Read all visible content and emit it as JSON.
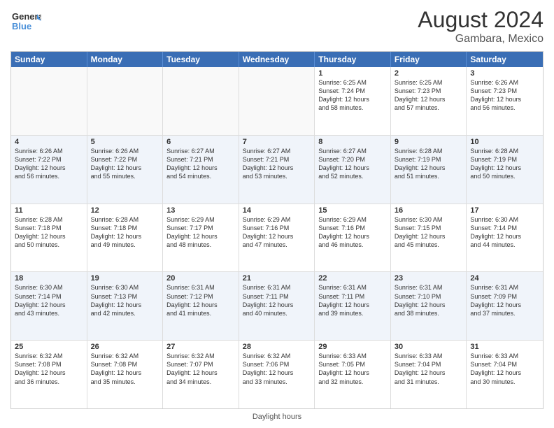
{
  "logo": {
    "general": "General",
    "blue": "Blue"
  },
  "title": "August 2024",
  "subtitle": "Gambara, Mexico",
  "days": [
    "Sunday",
    "Monday",
    "Tuesday",
    "Wednesday",
    "Thursday",
    "Friday",
    "Saturday"
  ],
  "rows": [
    [
      {
        "day": "",
        "text": "",
        "empty": true
      },
      {
        "day": "",
        "text": "",
        "empty": true
      },
      {
        "day": "",
        "text": "",
        "empty": true
      },
      {
        "day": "",
        "text": "",
        "empty": true
      },
      {
        "day": "1",
        "text": "Sunrise: 6:25 AM\nSunset: 7:24 PM\nDaylight: 12 hours\nand 58 minutes.",
        "empty": false
      },
      {
        "day": "2",
        "text": "Sunrise: 6:25 AM\nSunset: 7:23 PM\nDaylight: 12 hours\nand 57 minutes.",
        "empty": false
      },
      {
        "day": "3",
        "text": "Sunrise: 6:26 AM\nSunset: 7:23 PM\nDaylight: 12 hours\nand 56 minutes.",
        "empty": false
      }
    ],
    [
      {
        "day": "4",
        "text": "Sunrise: 6:26 AM\nSunset: 7:22 PM\nDaylight: 12 hours\nand 56 minutes.",
        "empty": false
      },
      {
        "day": "5",
        "text": "Sunrise: 6:26 AM\nSunset: 7:22 PM\nDaylight: 12 hours\nand 55 minutes.",
        "empty": false
      },
      {
        "day": "6",
        "text": "Sunrise: 6:27 AM\nSunset: 7:21 PM\nDaylight: 12 hours\nand 54 minutes.",
        "empty": false
      },
      {
        "day": "7",
        "text": "Sunrise: 6:27 AM\nSunset: 7:21 PM\nDaylight: 12 hours\nand 53 minutes.",
        "empty": false
      },
      {
        "day": "8",
        "text": "Sunrise: 6:27 AM\nSunset: 7:20 PM\nDaylight: 12 hours\nand 52 minutes.",
        "empty": false
      },
      {
        "day": "9",
        "text": "Sunrise: 6:28 AM\nSunset: 7:19 PM\nDaylight: 12 hours\nand 51 minutes.",
        "empty": false
      },
      {
        "day": "10",
        "text": "Sunrise: 6:28 AM\nSunset: 7:19 PM\nDaylight: 12 hours\nand 50 minutes.",
        "empty": false
      }
    ],
    [
      {
        "day": "11",
        "text": "Sunrise: 6:28 AM\nSunset: 7:18 PM\nDaylight: 12 hours\nand 50 minutes.",
        "empty": false
      },
      {
        "day": "12",
        "text": "Sunrise: 6:28 AM\nSunset: 7:18 PM\nDaylight: 12 hours\nand 49 minutes.",
        "empty": false
      },
      {
        "day": "13",
        "text": "Sunrise: 6:29 AM\nSunset: 7:17 PM\nDaylight: 12 hours\nand 48 minutes.",
        "empty": false
      },
      {
        "day": "14",
        "text": "Sunrise: 6:29 AM\nSunset: 7:16 PM\nDaylight: 12 hours\nand 47 minutes.",
        "empty": false
      },
      {
        "day": "15",
        "text": "Sunrise: 6:29 AM\nSunset: 7:16 PM\nDaylight: 12 hours\nand 46 minutes.",
        "empty": false
      },
      {
        "day": "16",
        "text": "Sunrise: 6:30 AM\nSunset: 7:15 PM\nDaylight: 12 hours\nand 45 minutes.",
        "empty": false
      },
      {
        "day": "17",
        "text": "Sunrise: 6:30 AM\nSunset: 7:14 PM\nDaylight: 12 hours\nand 44 minutes.",
        "empty": false
      }
    ],
    [
      {
        "day": "18",
        "text": "Sunrise: 6:30 AM\nSunset: 7:14 PM\nDaylight: 12 hours\nand 43 minutes.",
        "empty": false
      },
      {
        "day": "19",
        "text": "Sunrise: 6:30 AM\nSunset: 7:13 PM\nDaylight: 12 hours\nand 42 minutes.",
        "empty": false
      },
      {
        "day": "20",
        "text": "Sunrise: 6:31 AM\nSunset: 7:12 PM\nDaylight: 12 hours\nand 41 minutes.",
        "empty": false
      },
      {
        "day": "21",
        "text": "Sunrise: 6:31 AM\nSunset: 7:11 PM\nDaylight: 12 hours\nand 40 minutes.",
        "empty": false
      },
      {
        "day": "22",
        "text": "Sunrise: 6:31 AM\nSunset: 7:11 PM\nDaylight: 12 hours\nand 39 minutes.",
        "empty": false
      },
      {
        "day": "23",
        "text": "Sunrise: 6:31 AM\nSunset: 7:10 PM\nDaylight: 12 hours\nand 38 minutes.",
        "empty": false
      },
      {
        "day": "24",
        "text": "Sunrise: 6:31 AM\nSunset: 7:09 PM\nDaylight: 12 hours\nand 37 minutes.",
        "empty": false
      }
    ],
    [
      {
        "day": "25",
        "text": "Sunrise: 6:32 AM\nSunset: 7:08 PM\nDaylight: 12 hours\nand 36 minutes.",
        "empty": false
      },
      {
        "day": "26",
        "text": "Sunrise: 6:32 AM\nSunset: 7:08 PM\nDaylight: 12 hours\nand 35 minutes.",
        "empty": false
      },
      {
        "day": "27",
        "text": "Sunrise: 6:32 AM\nSunset: 7:07 PM\nDaylight: 12 hours\nand 34 minutes.",
        "empty": false
      },
      {
        "day": "28",
        "text": "Sunrise: 6:32 AM\nSunset: 7:06 PM\nDaylight: 12 hours\nand 33 minutes.",
        "empty": false
      },
      {
        "day": "29",
        "text": "Sunrise: 6:33 AM\nSunset: 7:05 PM\nDaylight: 12 hours\nand 32 minutes.",
        "empty": false
      },
      {
        "day": "30",
        "text": "Sunrise: 6:33 AM\nSunset: 7:04 PM\nDaylight: 12 hours\nand 31 minutes.",
        "empty": false
      },
      {
        "day": "31",
        "text": "Sunrise: 6:33 AM\nSunset: 7:04 PM\nDaylight: 12 hours\nand 30 minutes.",
        "empty": false
      }
    ]
  ],
  "footer": "Daylight hours"
}
